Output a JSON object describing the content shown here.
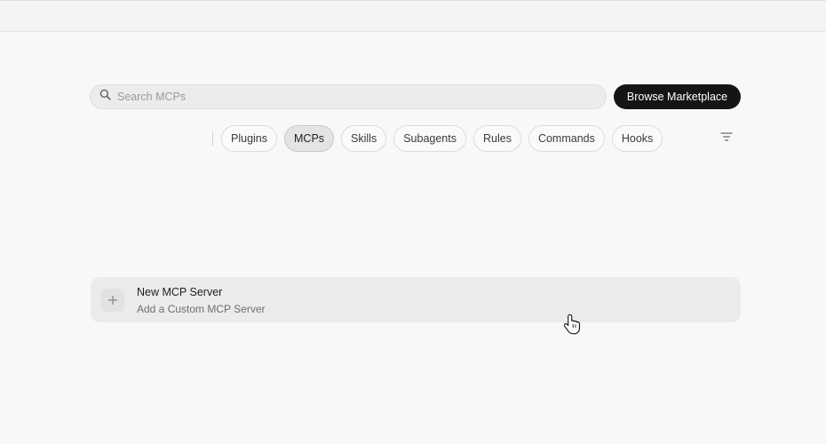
{
  "search": {
    "placeholder": "Search MCPs",
    "value": "",
    "icon": "search-icon"
  },
  "marketplace": {
    "label": "Browse Marketplace"
  },
  "tabs": [
    {
      "label": "Plugins",
      "active": false
    },
    {
      "label": "MCPs",
      "active": true
    },
    {
      "label": "Skills",
      "active": false
    },
    {
      "label": "Subagents",
      "active": false
    },
    {
      "label": "Rules",
      "active": false
    },
    {
      "label": "Commands",
      "active": false
    },
    {
      "label": "Hooks",
      "active": false
    }
  ],
  "filter": {
    "icon": "filter-icon"
  },
  "new_server": {
    "icon": "plus-icon",
    "title": "New MCP Server",
    "subtitle": "Add a Custom MCP Server"
  },
  "colors": {
    "background": "#f8f8f8",
    "primary_button": "#151515",
    "active_tab": "#e4e4e4"
  }
}
